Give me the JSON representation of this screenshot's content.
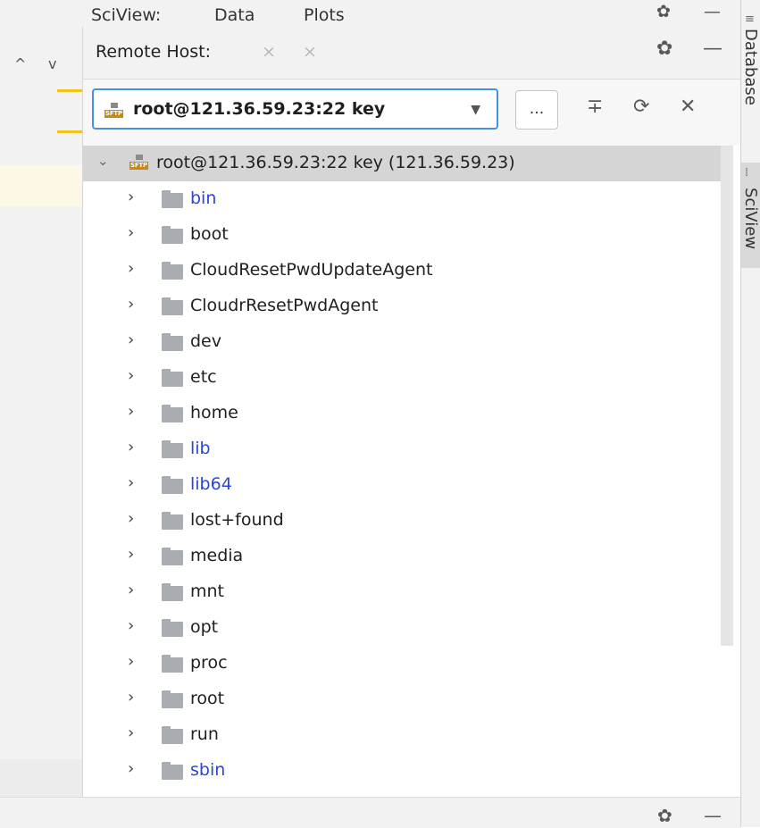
{
  "sciview_header": {
    "tabs": [
      "SciView:",
      "Data",
      "Plots"
    ]
  },
  "panel": {
    "title": "Remote Host:",
    "tab_close_1": "×",
    "tab_close_2": "×",
    "settings_glyph": "✿",
    "minimize_glyph": "—"
  },
  "toolbar": {
    "selected_host": "root@121.36.59.23:22 key",
    "badge_text": "SFTP",
    "caret": "▼",
    "more_label": "...",
    "collapse_glyph": "∓",
    "refresh_glyph": "⟳",
    "close_glyph": "✕"
  },
  "tree": {
    "root": {
      "label": "root@121.36.59.23:22 key (121.36.59.23)",
      "expand_glyph": "⌄"
    },
    "items": [
      {
        "name": "bin",
        "kind": "link"
      },
      {
        "name": "boot",
        "kind": "dir"
      },
      {
        "name": "CloudResetPwdUpdateAgent",
        "kind": "dir"
      },
      {
        "name": "CloudrResetPwdAgent",
        "kind": "dir"
      },
      {
        "name": "dev",
        "kind": "dir"
      },
      {
        "name": "etc",
        "kind": "dir"
      },
      {
        "name": "home",
        "kind": "dir"
      },
      {
        "name": "lib",
        "kind": "link"
      },
      {
        "name": "lib64",
        "kind": "link"
      },
      {
        "name": "lost+found",
        "kind": "dir"
      },
      {
        "name": "media",
        "kind": "dir"
      },
      {
        "name": "mnt",
        "kind": "dir"
      },
      {
        "name": "opt",
        "kind": "dir"
      },
      {
        "name": "proc",
        "kind": "dir"
      },
      {
        "name": "root",
        "kind": "dir"
      },
      {
        "name": "run",
        "kind": "dir"
      },
      {
        "name": "sbin",
        "kind": "link"
      }
    ]
  },
  "right_strip": {
    "database_label": "Database",
    "sciview_label": "SciView"
  },
  "left_strip": {
    "up_glyph": "^",
    "down_glyph": "v"
  },
  "colors": {
    "link": "#2a45d8",
    "focus_border": "#4a90e2",
    "selected_row": "#d5d5d5",
    "folder": "#a9acb0",
    "marker": "#f0c419"
  }
}
